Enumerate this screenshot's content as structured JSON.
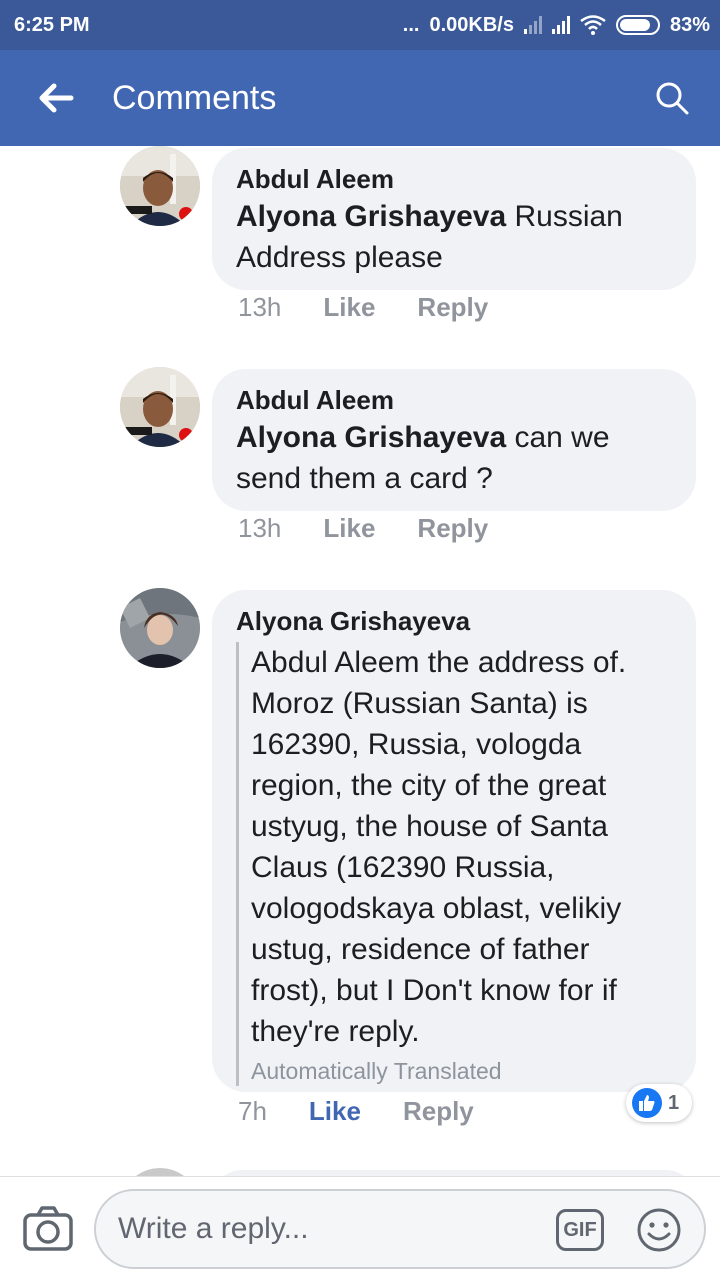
{
  "status_bar": {
    "time": "6:25 PM",
    "dots": "...",
    "network_speed": "0.00KB/s",
    "battery_percent": "83%",
    "battery_level": 0.83
  },
  "app_bar": {
    "title": "Comments",
    "back_icon": "arrow-left-icon",
    "search_icon": "search-icon"
  },
  "comments": [
    {
      "author": "Abdul Aleem",
      "mention": "Alyona Grishayeva",
      "text": " Russian Address please",
      "time": "13h",
      "like_label": "Like",
      "reply_label": "Reply"
    },
    {
      "author": "Abdul Aleem",
      "mention": "Alyona Grishayeva",
      "text": " can we send them a card ?",
      "time": "13h",
      "like_label": "Like",
      "reply_label": "Reply"
    },
    {
      "author": "Alyona Grishayeva",
      "text": "Abdul Aleem the address of. Moroz (Russian Santa) is 162390, Russia, vologda region, the city of the great ustyug, the house of Santa Claus (162390 Russia, vologodskaya oblast, velikiy ustug, residence of father frost), but I Don't know for if they're reply.",
      "translated_label": "Automatically Translated",
      "time": "7h",
      "like_label": "Like",
      "reply_label": "Reply",
      "reaction_count": "1",
      "liked": true
    }
  ],
  "composer": {
    "placeholder": "Write a reply...",
    "gif_label": "GIF",
    "camera_icon": "camera-icon",
    "emoji_icon": "emoji-icon"
  },
  "colors": {
    "status_bar": "#3b5998",
    "app_bar": "#4267b2",
    "bubble": "#f0f2f5",
    "like_active": "#4267b2"
  }
}
